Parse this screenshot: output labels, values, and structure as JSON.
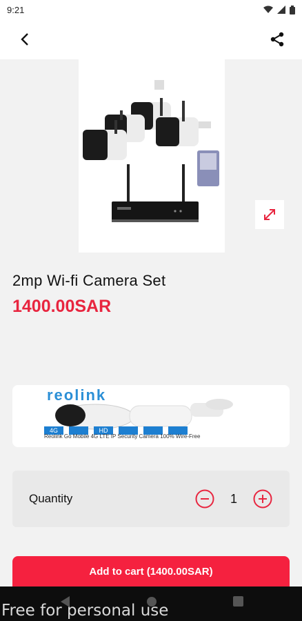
{
  "status_bar": {
    "time": "9:21"
  },
  "app_bar": {
    "back_icon": "back-arrow-icon",
    "share_icon": "share-icon"
  },
  "product": {
    "title": "2mp Wi-fi Camera Set",
    "price": "1400.00SAR",
    "image_icon": "camera-set-image"
  },
  "banner": {
    "brand": "reolink",
    "tags": [
      "4G",
      "",
      "HD",
      "",
      "",
      ""
    ],
    "text": "Reolink Go Mobile 4G LTE IP Security Camera 100% Wire-Free"
  },
  "quantity": {
    "label": "Quantity",
    "value": "1"
  },
  "cart_button": {
    "label": "Add to cart (1400.00SAR)"
  },
  "watermark": "Free for personal use",
  "colors": {
    "accent": "#f5213f",
    "price": "#e8253f",
    "brand_blue": "#2b8fd6"
  }
}
